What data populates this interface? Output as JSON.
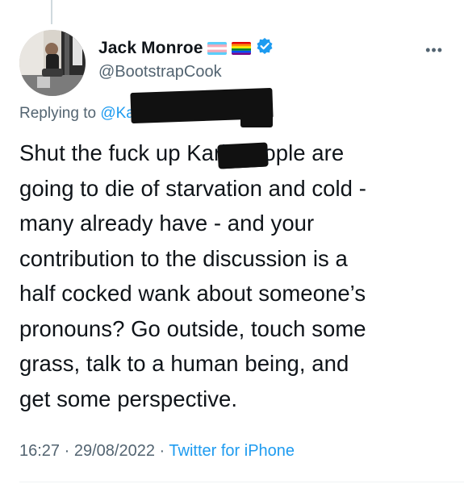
{
  "author": {
    "display_name": "Jack Monroe",
    "handle": "@BootstrapCook",
    "badges": [
      "transgender-flag-icon",
      "rainbow-flag-icon",
      "verified-badge-icon"
    ]
  },
  "reply": {
    "prefix": "Replying to",
    "mention": "@KarlWomack3"
  },
  "tweet": {
    "lines": [
      "Shut the fuck up Karl, people are",
      "going to die of starvation and cold -",
      "many already have - and your",
      "contribution to the discussion is a",
      "half cocked wank about someone’s",
      "pronouns? Go outside, touch some",
      "grass, talk to a human being, and",
      "get some perspective."
    ]
  },
  "meta": {
    "time": "16:27",
    "separator": "·",
    "date": "29/08/2022",
    "source": "Twitter for iPhone"
  },
  "colors": {
    "text": "#0f1419",
    "secondary": "#536471",
    "link": "#1d9bf0"
  }
}
